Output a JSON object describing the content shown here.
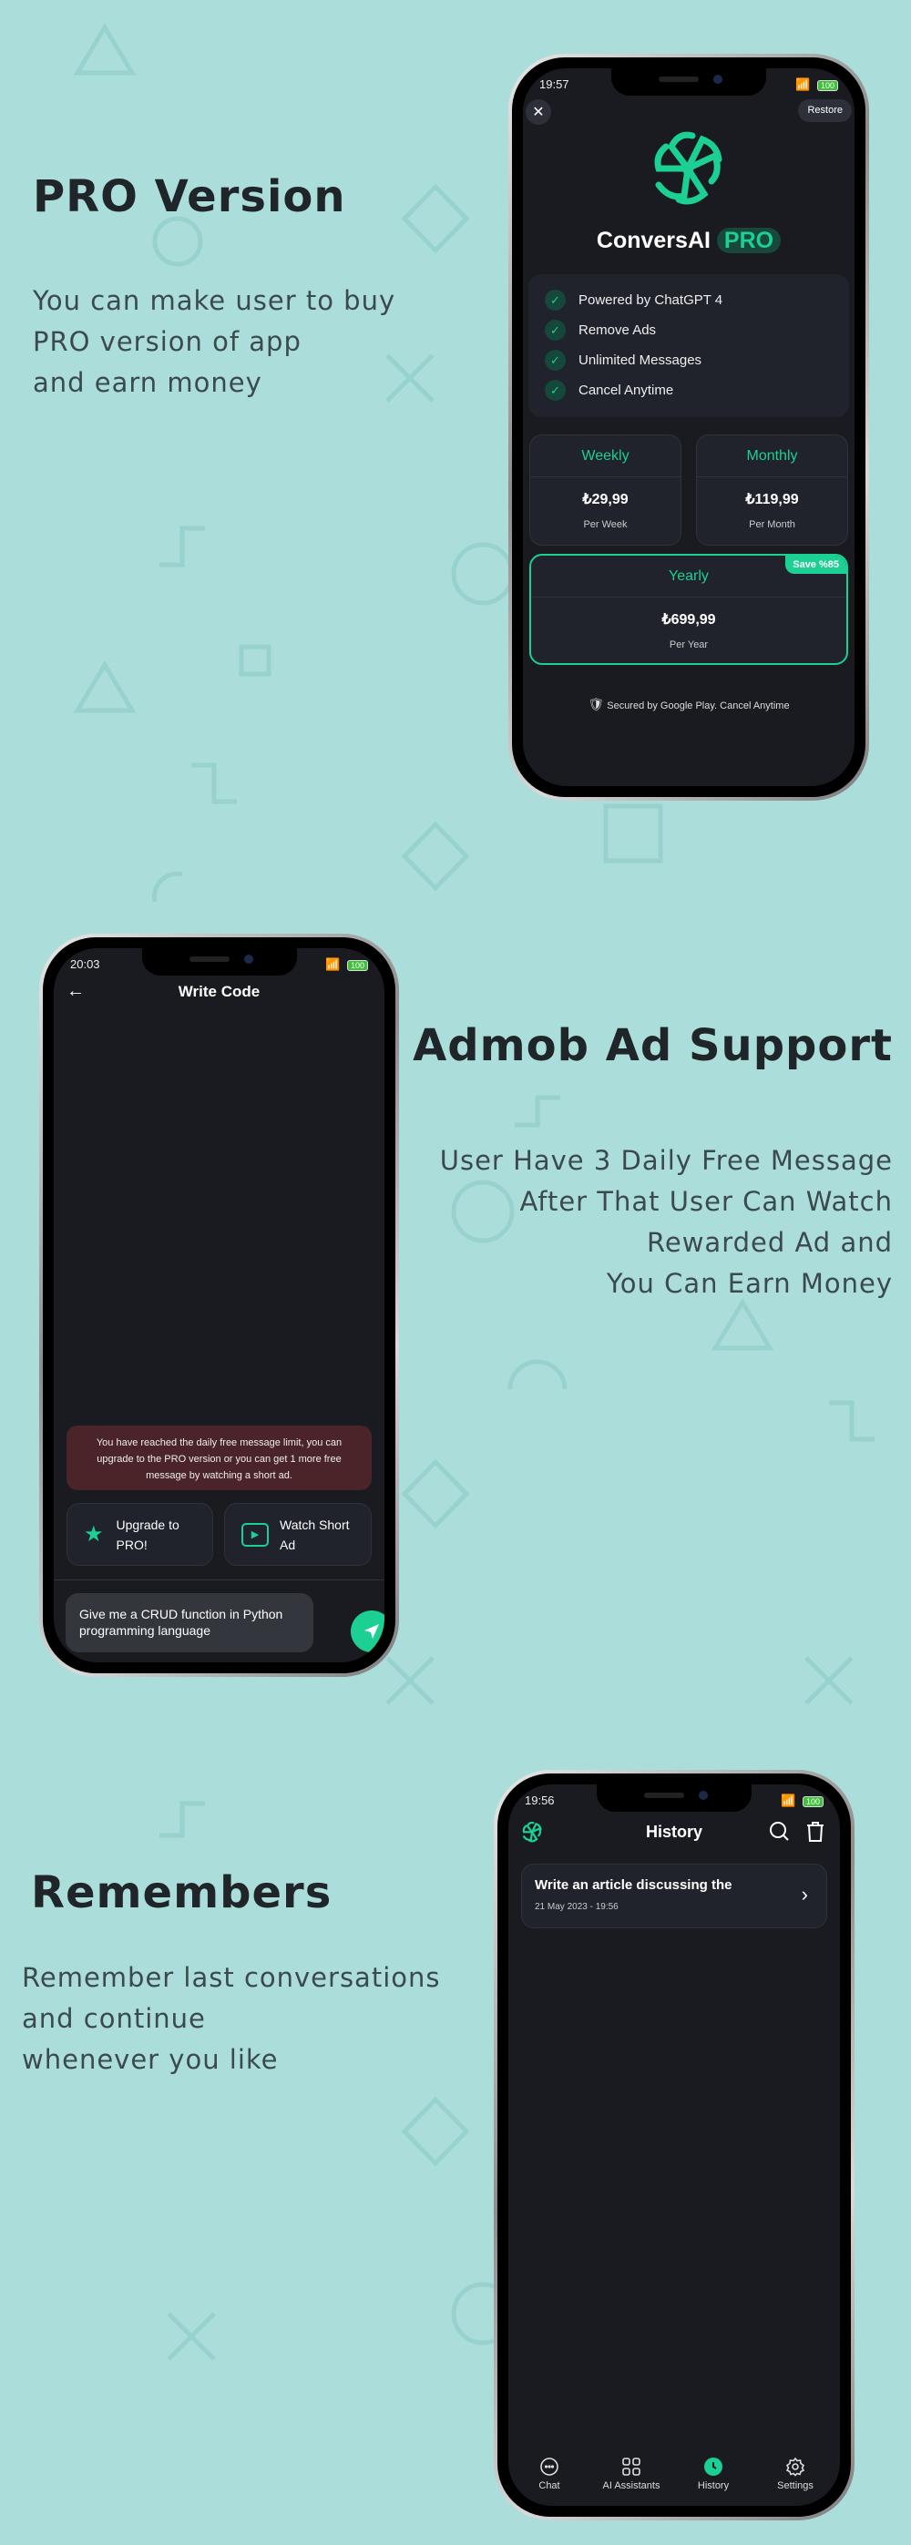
{
  "sections": {
    "pro": {
      "title": "PRO Version",
      "lines": [
        "You can make user to buy",
        "PRO version of app",
        "and earn money"
      ]
    },
    "admob": {
      "title": "Admob Ad Support",
      "lines": [
        "User Have 3 Daily Free Message",
        "After That User Can Watch",
        "Rewarded Ad and",
        "You Can Earn Money"
      ]
    },
    "remember": {
      "title": "Remembers",
      "lines": [
        "Remember last conversations",
        "and continue",
        "whenever you like"
      ]
    }
  },
  "phone1": {
    "time": "19:57",
    "battery": "100",
    "restore": "Restore",
    "app_name": "ConversAI",
    "pro_badge": "PRO",
    "features": [
      "Powered by ChatGPT 4",
      "Remove Ads",
      "Unlimited Messages",
      "Cancel Anytime"
    ],
    "plans": [
      {
        "name": "Weekly",
        "price": "₺29,99",
        "period": "Per Week"
      },
      {
        "name": "Monthly",
        "price": "₺119,99",
        "period": "Per Month"
      },
      {
        "name": "Yearly",
        "price": "₺699,99",
        "period": "Per Year",
        "badge": "Save %85",
        "selected": true
      }
    ],
    "secured": "Secured by Google Play. Cancel Anytime"
  },
  "phone2": {
    "time": "20:03",
    "battery": "100",
    "title": "Write Code",
    "notice": "You have reached the daily free message limit, you can upgrade to the PRO version or you can get 1 more free message by watching a short ad.",
    "upgrade": "Upgrade to PRO!",
    "watch": "Watch Short Ad",
    "input": "Give me a CRUD function in Python programming language"
  },
  "phone3": {
    "time": "19:56",
    "battery": "100",
    "title": "History",
    "items": [
      {
        "title": "Write an article discussing the",
        "date": "21 May 2023 - 19:56"
      }
    ],
    "nav": [
      {
        "label": "Chat",
        "icon": "chat-bubble"
      },
      {
        "label": "AI Assistants",
        "icon": "grid"
      },
      {
        "label": "History",
        "icon": "clock",
        "active": true
      },
      {
        "label": "Settings",
        "icon": "gear"
      }
    ]
  },
  "colors": {
    "background": "#abdedb",
    "accent": "#1ccf93",
    "screen": "#1a1b20",
    "notice": "#4a2428"
  }
}
